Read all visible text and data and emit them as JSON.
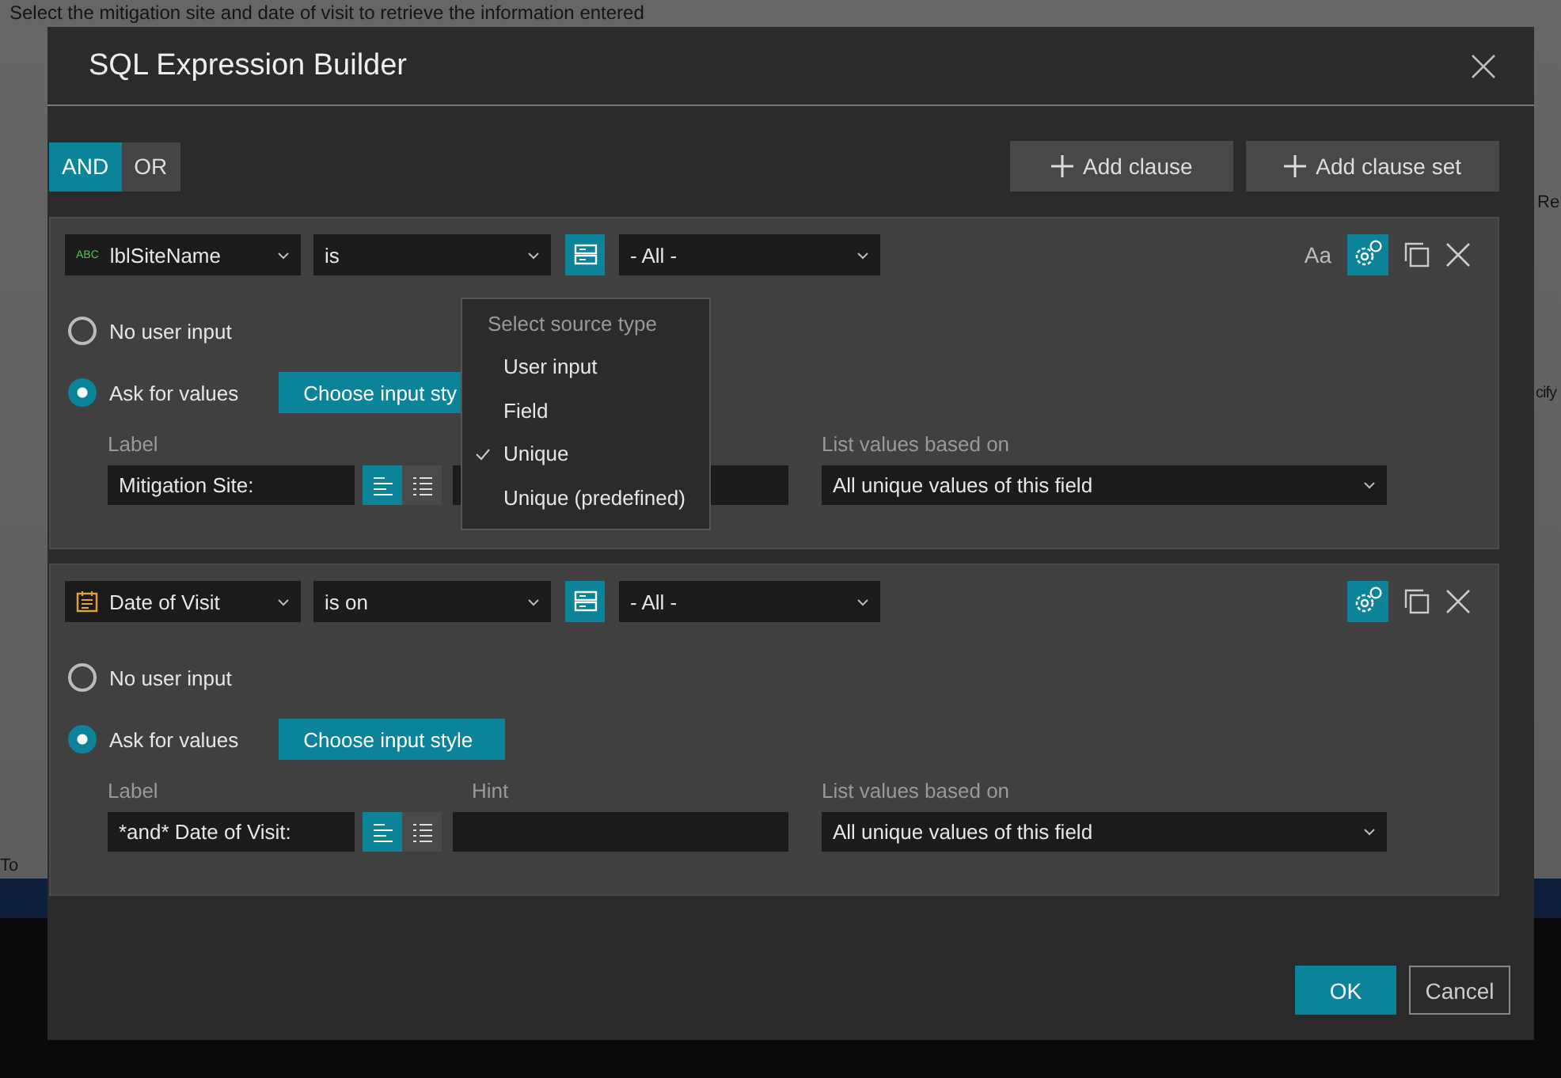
{
  "background_page": {
    "instruction": "Select the mitigation site and date of visit to retrieve the information entered",
    "fragments": [
      {
        "text": "Re"
      },
      {
        "text": "cify"
      },
      {
        "text": "To"
      }
    ]
  },
  "dialog": {
    "title": "SQL Expression Builder",
    "logic": [
      {
        "label": "AND",
        "selected": true
      },
      {
        "label": "OR",
        "selected": false
      }
    ],
    "actions": [
      "Add clause",
      "Add clause set"
    ],
    "clauses": [
      {
        "kind": "string",
        "type_text": "ABC",
        "field": "lblSiteName",
        "operator": "is",
        "value": "- All -",
        "case_button": "Aa",
        "settings_active": true,
        "options": [
          {
            "label": "No user input",
            "selected": false
          },
          {
            "label": "Ask for values",
            "selected": true
          }
        ],
        "style_button": "Choose input sty",
        "label_caption": "Label",
        "label_value": "Mitigation Site:",
        "layout_toggles": [
          {
            "selected": true
          },
          {
            "selected": false
          }
        ],
        "list_caption": "List values based on",
        "list_value": "All unique values of this field",
        "source_menu": {
          "title": "Select source type",
          "items": [
            {
              "label": "User input",
              "checked": false
            },
            {
              "label": "Field",
              "checked": false
            },
            {
              "label": "Unique",
              "checked": true
            },
            {
              "label": "Unique (predefined)",
              "checked": false
            }
          ]
        }
      },
      {
        "kind": "date",
        "field": "Date of Visit",
        "operator": "is on",
        "value": "- All -",
        "settings_active": true,
        "options": [
          {
            "label": "No user input",
            "selected": false
          },
          {
            "label": "Ask for values",
            "selected": true
          }
        ],
        "style_button": "Choose input style",
        "label_caption": "Label",
        "label_value": "*and* Date of Visit:",
        "layout_toggles": [
          {
            "selected": true
          },
          {
            "selected": false
          }
        ],
        "hint_caption": "Hint",
        "list_caption": "List values based on",
        "list_value": "All unique values of this field"
      }
    ],
    "footer": [
      {
        "label": "OK",
        "kind": "primary"
      },
      {
        "label": "Cancel",
        "kind": "secondary"
      }
    ]
  }
}
